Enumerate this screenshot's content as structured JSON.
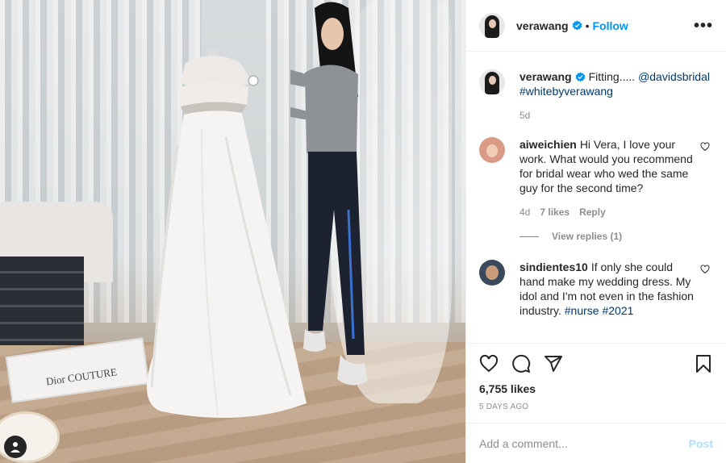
{
  "header": {
    "username": "verawang",
    "separator": "•",
    "follow_label": "Follow",
    "more_label": "•••",
    "verified_icon": "verified-badge-icon",
    "accent": "#0095f6"
  },
  "caption": {
    "username": "verawang",
    "text": "Fitting..... ",
    "mention": "@davidsbridal",
    "hashtag": "#whitebyverawang",
    "age": "5d"
  },
  "comments": [
    {
      "username": "aiweichien",
      "text": "Hi Vera, I love your work. What would you recommend for bridal wear who wed the same guy for the second time?",
      "age": "4d",
      "likes": "7 likes",
      "reply_label": "Reply",
      "view_replies": "View replies (1)"
    },
    {
      "username": "sindientes10",
      "text": "If only she could hand make my wedding dress. My idol and I'm not even in the fashion industry. ",
      "hashtags": "#nurse #2021"
    }
  ],
  "actions": {
    "icons": [
      "heart-icon",
      "comment-icon",
      "share-icon",
      "bookmark-icon"
    ],
    "likes": "6,755 likes",
    "age": "5 DAYS AGO"
  },
  "add_comment": {
    "placeholder": "Add a comment...",
    "post_label": "Post",
    "post_color": "#b2dffc"
  },
  "photo": {
    "book_text": "Dior COUTURE"
  }
}
